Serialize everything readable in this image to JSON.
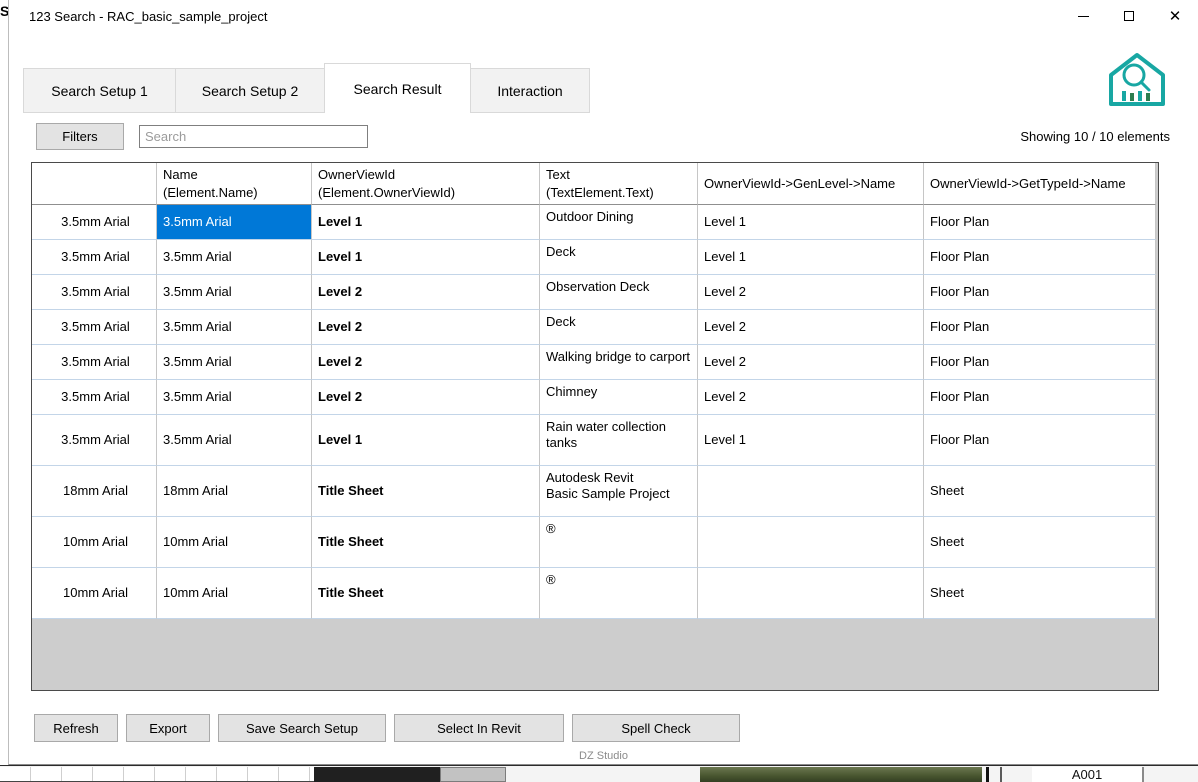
{
  "window": {
    "title": "123 Search - RAC_basic_sample_project",
    "close_glyph": "✕"
  },
  "background": {
    "left_fragment": "S",
    "sheet_label": "A001"
  },
  "tabs": [
    {
      "label": "Search Setup 1"
    },
    {
      "label": "Search Setup 2"
    },
    {
      "label": "Search Result"
    },
    {
      "label": "Interaction"
    }
  ],
  "toolbar": {
    "filters_label": "Filters",
    "search_placeholder": "Search",
    "showing_text": "Showing 10 / 10 elements"
  },
  "table": {
    "columns": [
      {
        "key": "row_header",
        "line1": "",
        "line2": ""
      },
      {
        "key": "name",
        "line1": "Name",
        "line2": "(Element.Name)"
      },
      {
        "key": "owner_view",
        "line1": "OwnerViewId",
        "line2": "(Element.OwnerViewId)"
      },
      {
        "key": "text",
        "line1": "Text",
        "line2": "(TextElement.Text)"
      },
      {
        "key": "gen_level",
        "line1": "OwnerViewId->GenLevel->Name",
        "line2": ""
      },
      {
        "key": "type_name",
        "line1": "OwnerViewId->GetTypeId->Name",
        "line2": ""
      }
    ],
    "rows": [
      {
        "row_header": "3.5mm Arial",
        "name": "3.5mm Arial",
        "owner_view": "Level 1",
        "text": "Outdoor Dining",
        "gen_level": "Level 1",
        "type_name": "Floor Plan",
        "selected_cell": "name"
      },
      {
        "row_header": "3.5mm Arial",
        "name": "3.5mm Arial",
        "owner_view": "Level 1",
        "text": "Deck",
        "gen_level": "Level 1",
        "type_name": "Floor Plan"
      },
      {
        "row_header": "3.5mm Arial",
        "name": "3.5mm Arial",
        "owner_view": "Level 2",
        "text": "Observation Deck",
        "gen_level": "Level 2",
        "type_name": "Floor Plan"
      },
      {
        "row_header": "3.5mm Arial",
        "name": "3.5mm Arial",
        "owner_view": "Level 2",
        "text": "Deck",
        "gen_level": "Level 2",
        "type_name": "Floor Plan"
      },
      {
        "row_header": "3.5mm Arial",
        "name": "3.5mm Arial",
        "owner_view": "Level 2",
        "text": "Walking bridge to carport",
        "gen_level": "Level 2",
        "type_name": "Floor Plan"
      },
      {
        "row_header": "3.5mm Arial",
        "name": "3.5mm Arial",
        "owner_view": "Level 2",
        "text": "Chimney",
        "gen_level": "Level 2",
        "type_name": "Floor Plan"
      },
      {
        "row_header": "3.5mm Arial",
        "name": "3.5mm Arial",
        "owner_view": "Level 1",
        "text": "Rain water collection\ntanks",
        "gen_level": "Level 1",
        "type_name": "Floor Plan"
      },
      {
        "row_header": "18mm Arial",
        "name": "18mm Arial",
        "owner_view": "Title Sheet",
        "text": "Autodesk  Revit\nBasic Sample Project",
        "gen_level": "",
        "type_name": "Sheet"
      },
      {
        "row_header": "10mm Arial",
        "name": "10mm Arial",
        "owner_view": "Title Sheet",
        "text": "®",
        "gen_level": "",
        "type_name": "Sheet"
      },
      {
        "row_header": "10mm Arial",
        "name": "10mm Arial",
        "owner_view": "Title Sheet",
        "text": "®",
        "gen_level": "",
        "type_name": "Sheet"
      }
    ]
  },
  "footer": {
    "buttons": [
      "Refresh",
      "Export",
      "Save Search Setup",
      "Select In Revit",
      "Spell Check"
    ],
    "studio_label": "DZ Studio"
  },
  "colors": {
    "selection": "#0078d7",
    "logo_teal": "#18a7a3",
    "logo_green": "#2e7d4f"
  }
}
